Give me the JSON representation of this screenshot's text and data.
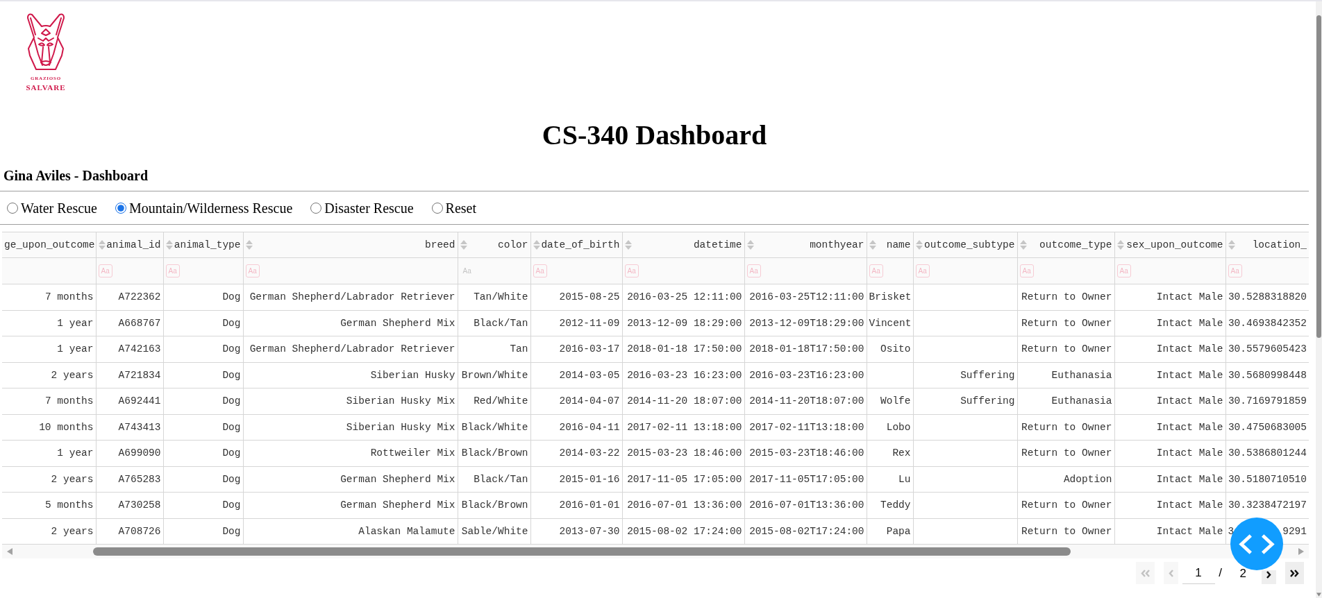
{
  "logo": {
    "line1": "GRAZIOSO",
    "line2": "SALVARE"
  },
  "title": "CS-340 Dashboard",
  "subtitle": "Gina Aviles - Dashboard",
  "radio_options": [
    {
      "label": "Water Rescue",
      "selected": false
    },
    {
      "label": "Mountain/Wilderness Rescue",
      "selected": true
    },
    {
      "label": "Disaster Rescue",
      "selected": false
    },
    {
      "label": "Reset",
      "selected": false
    }
  ],
  "table": {
    "columns": [
      {
        "label": "ge_upon_outcome",
        "kind": "partial"
      },
      {
        "label": "animal_id",
        "kind": "full",
        "filter": {
          "toggle": "Aa",
          "highlighted": true
        }
      },
      {
        "label": "animal_type",
        "kind": "full",
        "filter": {
          "toggle": "Aa",
          "highlighted": true
        }
      },
      {
        "label": "breed",
        "kind": "full",
        "filter": {
          "toggle": "Aa",
          "highlighted": true
        }
      },
      {
        "label": "color",
        "kind": "full",
        "filter": {
          "toggle": "Aa",
          "highlighted": false
        }
      },
      {
        "label": "date_of_birth",
        "kind": "full",
        "filter": {
          "toggle": "Aa",
          "highlighted": true
        }
      },
      {
        "label": "datetime",
        "kind": "full",
        "filter": {
          "toggle": "Aa",
          "highlighted": true
        }
      },
      {
        "label": "monthyear",
        "kind": "full",
        "filter": {
          "toggle": "Aa",
          "highlighted": true
        }
      },
      {
        "label": "name",
        "kind": "full",
        "filter": {
          "toggle": "Aa",
          "highlighted": true
        }
      },
      {
        "label": "outcome_subtype",
        "kind": "full",
        "filter": {
          "toggle": "Aa",
          "highlighted": true
        }
      },
      {
        "label": "outcome_type",
        "kind": "full",
        "filter": {
          "toggle": "Aa",
          "highlighted": true
        }
      },
      {
        "label": "sex_upon_outcome",
        "kind": "full",
        "filter": {
          "toggle": "Aa",
          "highlighted": true
        }
      },
      {
        "label": "location_",
        "kind": "full",
        "filter": {
          "toggle": "Aa",
          "highlighted": true
        }
      }
    ],
    "rows": [
      [
        "7 months",
        "A722362",
        "Dog",
        "German Shepherd/Labrador Retriever",
        "Tan/White",
        "2015-08-25",
        "2016-03-25 12:11:00",
        "2016-03-25T12:11:00",
        "Brisket",
        null,
        "Return to Owner",
        "Intact Male",
        "30.5288318820"
      ],
      [
        "1 year",
        "A668767",
        "Dog",
        "German Shepherd Mix",
        "Black/Tan",
        "2012-11-09",
        "2013-12-09 18:29:00",
        "2013-12-09T18:29:00",
        "Vincent",
        null,
        "Return to Owner",
        "Intact Male",
        "30.4693842352"
      ],
      [
        "1 year",
        "A742163",
        "Dog",
        "German Shepherd/Labrador Retriever",
        "Tan",
        "2016-03-17",
        "2018-01-18 17:50:00",
        "2018-01-18T17:50:00",
        "Osito",
        null,
        "Return to Owner",
        "Intact Male",
        "30.5579605423"
      ],
      [
        "2 years",
        "A721834",
        "Dog",
        "Siberian Husky",
        "Brown/White",
        "2014-03-05",
        "2016-03-23 16:23:00",
        "2016-03-23T16:23:00",
        null,
        "Suffering",
        "Euthanasia",
        "Intact Male",
        "30.5680998448"
      ],
      [
        "7 months",
        "A692441",
        "Dog",
        "Siberian Husky Mix",
        "Red/White",
        "2014-04-07",
        "2014-11-20 18:07:00",
        "2014-11-20T18:07:00",
        "Wolfe",
        "Suffering",
        "Euthanasia",
        "Intact Male",
        "30.7169791859"
      ],
      [
        "10 months",
        "A743413",
        "Dog",
        "Siberian Husky Mix",
        "Black/White",
        "2016-04-11",
        "2017-02-11 13:18:00",
        "2017-02-11T13:18:00",
        "Lobo",
        null,
        "Return to Owner",
        "Intact Male",
        "30.4750683005"
      ],
      [
        "1 year",
        "A699090",
        "Dog",
        "Rottweiler Mix",
        "Black/Brown",
        "2014-03-22",
        "2015-03-23 18:46:00",
        "2015-03-23T18:46:00",
        "Rex",
        null,
        "Return to Owner",
        "Intact Male",
        "30.5386801244"
      ],
      [
        "2 years",
        "A765283",
        "Dog",
        "German Shepherd Mix",
        "Black/Tan",
        "2015-01-16",
        "2017-11-05 17:05:00",
        "2017-11-05T17:05:00",
        "Lu",
        null,
        "Adoption",
        "Intact Male",
        "30.5180710510"
      ],
      [
        "5 months",
        "A730258",
        "Dog",
        "German Shepherd Mix",
        "Black/Brown",
        "2016-01-01",
        "2016-07-01 13:36:00",
        "2016-07-01T13:36:00",
        "Teddy",
        null,
        "Return to Owner",
        "Intact Male",
        "30.3238472197"
      ],
      [
        "2 years",
        "A708726",
        "Dog",
        "Alaskan Malamute",
        "Sable/White",
        "2013-07-30",
        "2015-08-02 17:24:00",
        "2015-08-02T17:24:00",
        "Papa",
        null,
        "Return to Owner",
        "Intact Male",
        [
          "3",
          "9291"
        ]
      ]
    ]
  },
  "pagination": {
    "buttons": [
      {
        "kind": "first",
        "disabled": true
      },
      {
        "kind": "previous",
        "disabled": true
      },
      {
        "kind": "next",
        "disabled": false
      },
      {
        "kind": "last",
        "disabled": false
      }
    ],
    "page": "1",
    "separator": "/",
    "total": "2"
  }
}
